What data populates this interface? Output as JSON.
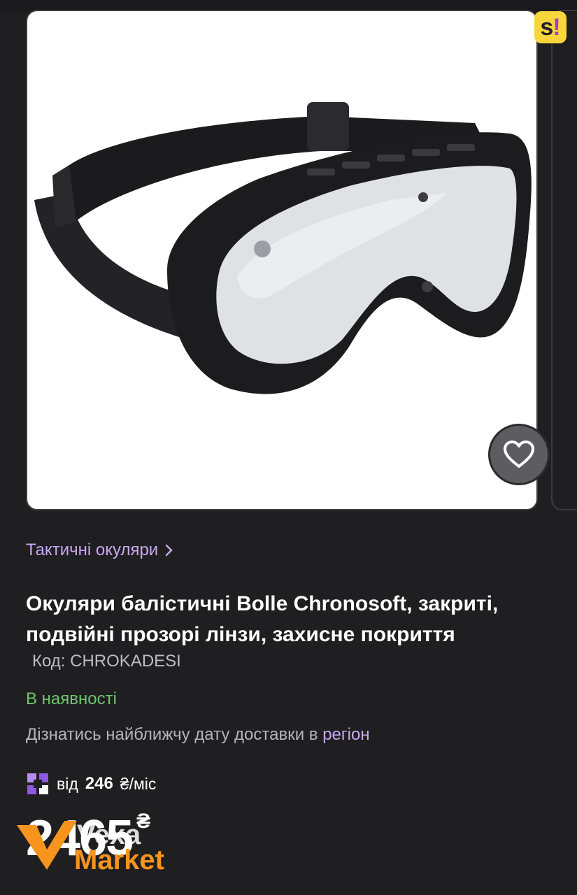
{
  "product": {
    "category_link": "Тактичні окуляри",
    "title": "Окуляри балістичні Bolle Chronosoft, закриті, подвійні прозорі лінзи, захисне покриття",
    "sku": "Код: CHROKADESI",
    "availability": "В наявності",
    "delivery_text": "Дізнатись найближчу дату доставки в",
    "delivery_link": "регіон",
    "installment_prefix": "від",
    "installment_amount": "246",
    "installment_suffix": "₴/міс",
    "price": "2465",
    "currency": "₴"
  },
  "image": {
    "alt_icon": "goggles-image"
  },
  "badge": {
    "text_s": "s",
    "text_excl": "!"
  },
  "watermark": {
    "line1": "Vexa",
    "line2": "Market"
  },
  "colors": {
    "background": "#1f1e20",
    "accent_purple": "#c8a8f2",
    "in_stock_green": "#6cc86c",
    "watermark_orange": "#f7941d"
  }
}
